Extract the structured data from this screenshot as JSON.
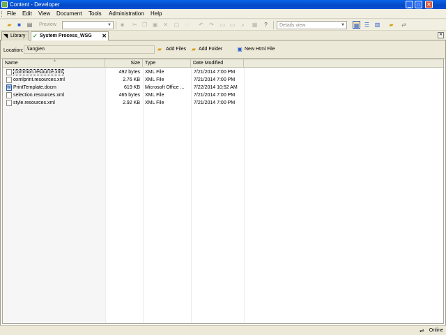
{
  "window": {
    "title": "Content - Developer",
    "controls": [
      "_",
      "□",
      "✕"
    ]
  },
  "menu": [
    "File",
    "Edit",
    "View",
    "Document",
    "Tools",
    "Administration",
    "Help"
  ],
  "toolbar": {
    "preview_label": "Preview",
    "view_combo_value": "Details view"
  },
  "tabs": [
    {
      "label": "Library",
      "icon": "library-icon"
    },
    {
      "label": "System Process_WSG",
      "icon": "check-icon",
      "close": "✕"
    }
  ],
  "tabbar_close": "✕",
  "location": {
    "label": "Location:",
    "value": ".\\lang\\en",
    "actions": [
      {
        "label": "Add Files",
        "icon": "add-files-icon"
      },
      {
        "label": "Add Folder",
        "icon": "add-folder-icon"
      },
      {
        "label": "New Html File",
        "icon": "new-html-file-icon"
      }
    ]
  },
  "file_list": {
    "columns": [
      "Name",
      "Size",
      "Type",
      "Date Modified"
    ],
    "rows": [
      {
        "name": "common.resource.xml",
        "size": "492 bytes",
        "type": "XML File",
        "date": "7/21/2014 7:00 PM",
        "icon": "xml-file-icon"
      },
      {
        "name": "oxmlprint.resources.xml",
        "size": "2.76 KB",
        "type": "XML File",
        "date": "7/21/2014 7:00 PM",
        "icon": "xml-file-icon"
      },
      {
        "name": "PrintTemplate.docm",
        "size": "619 KB",
        "type": "Microsoft Office ...",
        "date": "7/22/2014 10:52 AM",
        "icon": "word-file-icon"
      },
      {
        "name": "selection.resources.xml",
        "size": "465 bytes",
        "type": "XML File",
        "date": "7/21/2014 7:00 PM",
        "icon": "xml-file-icon"
      },
      {
        "name": "style.resources.xml",
        "size": "2.92 KB",
        "type": "XML File",
        "date": "7/21/2014 7:00 PM",
        "icon": "xml-file-icon"
      }
    ]
  },
  "status": {
    "text": "Online",
    "icon": "online-icon"
  }
}
